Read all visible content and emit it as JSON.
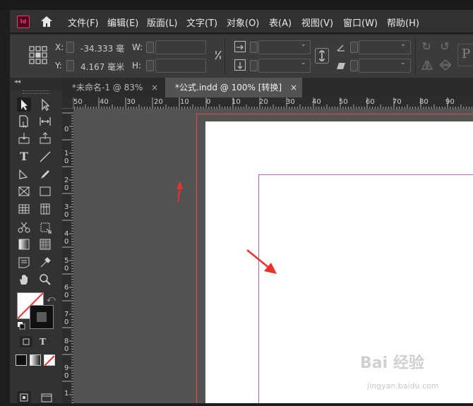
{
  "app": {
    "logo_text": "Id"
  },
  "menu": [
    {
      "label": "文件(F)"
    },
    {
      "label": "编辑(E)"
    },
    {
      "label": "版面(L)"
    },
    {
      "label": "文字(T)"
    },
    {
      "label": "对象(O)"
    },
    {
      "label": "表(A)"
    },
    {
      "label": "视图(V)"
    },
    {
      "label": "窗口(W)"
    },
    {
      "label": "帮助(H)"
    }
  ],
  "control": {
    "x_label": "X:",
    "x_value": "-34.333 毫",
    "y_label": "Y:",
    "y_value": "4.167 毫米",
    "w_label": "W:",
    "w_value": "",
    "h_label": "H:",
    "h_value": "",
    "p_glyph": "P"
  },
  "tabs": [
    {
      "label": "*未命名-1 @ 83%",
      "close": "×"
    },
    {
      "label": "*公式.indd @ 100% [转换]",
      "close": "×"
    }
  ],
  "hruler": [
    "50",
    "40",
    "30",
    "20",
    "10",
    "0",
    "10",
    "20",
    "30",
    "40",
    "50",
    "60",
    "70",
    "80",
    "90"
  ],
  "vruler": [
    "0",
    "1 0",
    "2 0",
    "3 0",
    "4 0",
    "5 0",
    "6 0",
    "7 0",
    "8 0",
    "9 0",
    "1"
  ],
  "toolbox_text": {
    "text_tool": "T",
    "type_toggle": "T"
  },
  "watermark": {
    "main": "Bai 经验",
    "url": "jingyan.baidu.com"
  },
  "colors": {
    "bleed": "#e84a4a",
    "margin": "#b060c0",
    "arrow": "#e8312d",
    "logo": "#ff3366"
  }
}
